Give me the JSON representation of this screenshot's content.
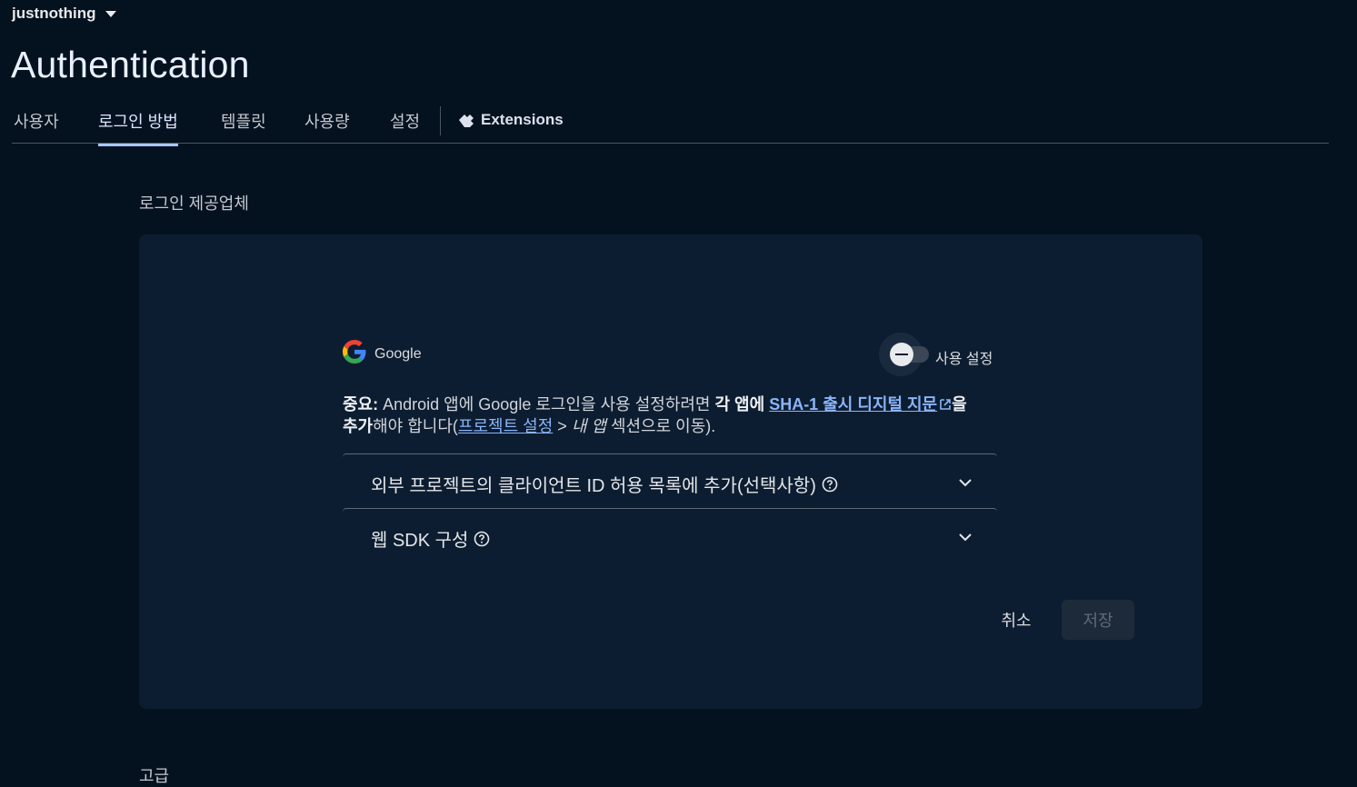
{
  "project": {
    "name": "justnothing"
  },
  "page": {
    "title": "Authentication"
  },
  "tabs": [
    {
      "label": "사용자"
    },
    {
      "label": "로그인 방법"
    },
    {
      "label": "템플릿"
    },
    {
      "label": "사용량"
    },
    {
      "label": "설정"
    },
    {
      "label": "Extensions"
    }
  ],
  "section": {
    "label": "로그인 제공업체"
  },
  "provider": {
    "name": "Google",
    "toggle_label": "사용 설정",
    "enabled": false,
    "icon": "google-g-logo"
  },
  "notice": {
    "important": "중요:",
    "text1": " Android 앱에 Google 로그인을 사용 설정하려면 ",
    "bold1": "각 앱에 ",
    "link1": "SHA-1 출시 디지털 지문",
    "after_link1": "을",
    "bold2": "추가",
    "text2": "해야 합니다(",
    "link2": "프로젝트 설정",
    "text3": " > ",
    "italic": "내 앱",
    "text4": " 섹션으로 이동)."
  },
  "accordions": [
    {
      "title": "외부 프로젝트의 클라이언트 ID 허용 목록에 추가(선택사항)"
    },
    {
      "title": "웹 SDK 구성"
    }
  ],
  "buttons": {
    "cancel": "취소",
    "save": "저장"
  },
  "advanced": {
    "label": "고급"
  },
  "colors": {
    "background": "#04111f",
    "card": "#0d1d31",
    "accent": "#a8c7fa",
    "link": "#8ab4f8"
  }
}
